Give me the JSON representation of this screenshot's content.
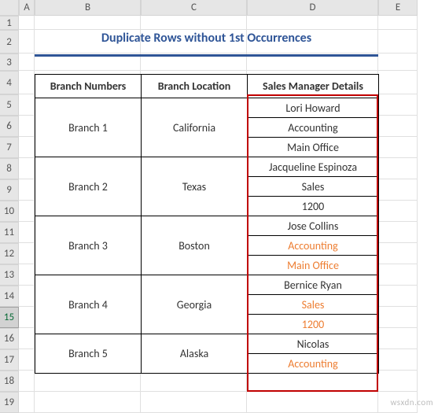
{
  "col_headers": [
    "A",
    "B",
    "C",
    "D",
    "E"
  ],
  "row_headers": [
    "1",
    "2",
    "3",
    "4",
    "5",
    "6",
    "7",
    "8",
    "9",
    "10",
    "11",
    "12",
    "13",
    "14",
    "15",
    "16",
    "17",
    "18",
    "19"
  ],
  "selected_row": "15",
  "title": "Duplicate Rows without 1st Occurrences",
  "table": {
    "headers": [
      "Branch Numbers",
      "Branch Location",
      "Sales Manager Details"
    ],
    "rows": [
      {
        "branch": "Branch 1",
        "location": "California",
        "details": [
          {
            "text": "Lori Howard",
            "dup": false
          },
          {
            "text": "Accounting",
            "dup": false
          },
          {
            "text": "Main Office",
            "dup": false
          }
        ]
      },
      {
        "branch": "Branch 2",
        "location": "Texas",
        "details": [
          {
            "text": "Jacqueline Espinoza",
            "dup": false
          },
          {
            "text": "Sales",
            "dup": false
          },
          {
            "text": "1200",
            "dup": false
          }
        ]
      },
      {
        "branch": "Branch 3",
        "location": "Boston",
        "details": [
          {
            "text": "Jose Collins",
            "dup": false
          },
          {
            "text": "Accounting",
            "dup": true
          },
          {
            "text": "Main Office",
            "dup": true
          }
        ]
      },
      {
        "branch": "Branch 4",
        "location": "Georgia",
        "details": [
          {
            "text": "Bernice Ryan",
            "dup": false
          },
          {
            "text": "Sales",
            "dup": true
          },
          {
            "text": "1200",
            "dup": true
          }
        ]
      },
      {
        "branch": "Branch 5",
        "location": "Alaska",
        "details": [
          {
            "text": "Nicolas",
            "dup": false
          },
          {
            "text": "Accounting",
            "dup": true
          }
        ]
      }
    ]
  },
  "watermark": "wsxdn.com"
}
